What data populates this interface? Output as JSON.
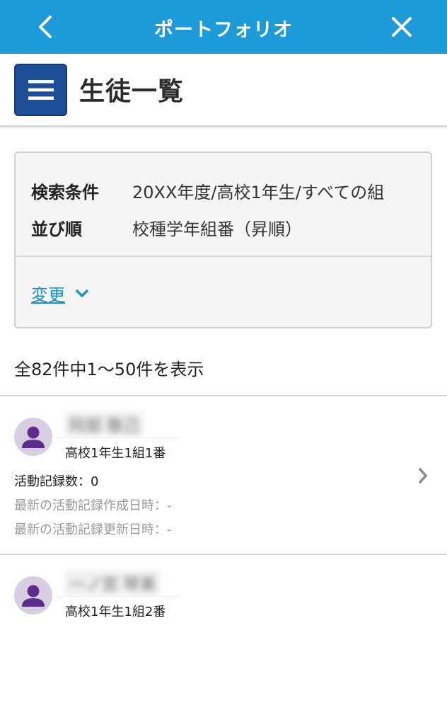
{
  "topbar": {
    "title": "ポートフォリオ",
    "back_icon": "chevron-left-icon",
    "close_icon": "close-icon",
    "color": "#1d9bd8"
  },
  "header": {
    "title": "生徒一覧",
    "menu_icon": "hamburger-menu-icon",
    "menu_color": "#1e4f96"
  },
  "search": {
    "condition_label": "検索条件",
    "condition_value": "20XX年度/高校1年生/すべての組",
    "sort_label": "並び順",
    "sort_value": "校種学年組番（昇順）",
    "change_label": "変更",
    "link_color": "#1e8fd0"
  },
  "results": {
    "summary": "全82件中1～50件を表示"
  },
  "students": [
    {
      "name": "阿部 敬己",
      "class": "高校1年生1組1番",
      "activity_count": "活動記録数：0",
      "last_created": "最新の活動記録作成日時：-",
      "last_updated": "最新の活動記録更新日時：-"
    },
    {
      "name": "一ノ宮 琴美",
      "class": "高校1年生1組2番"
    }
  ]
}
